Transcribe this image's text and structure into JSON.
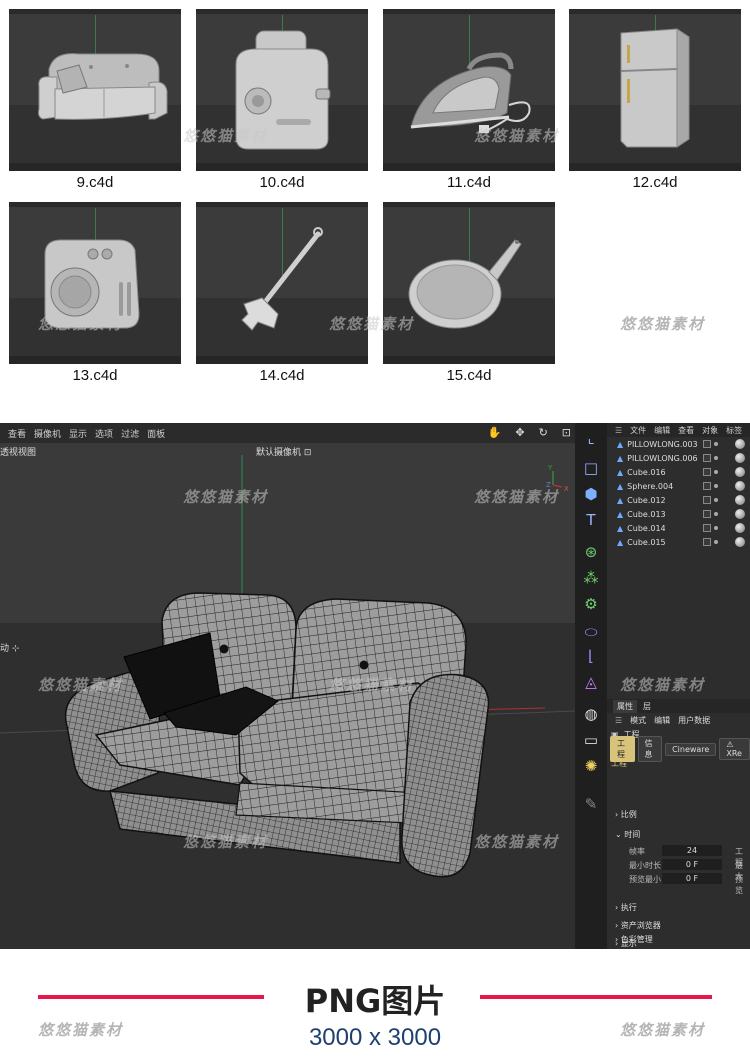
{
  "thumbnails": [
    {
      "caption": "9.c4d",
      "icon": "sofa-model"
    },
    {
      "caption": "10.c4d",
      "icon": "toaster-model"
    },
    {
      "caption": "11.c4d",
      "icon": "iron-model"
    },
    {
      "caption": "12.c4d",
      "icon": "fridge-model"
    },
    {
      "caption": "13.c4d",
      "icon": "washing-machine-model"
    },
    {
      "caption": "14.c4d",
      "icon": "mop-model"
    },
    {
      "caption": "15.c4d",
      "icon": "frying-pan-model"
    }
  ],
  "watermark": "悠悠猫素材",
  "viewport": {
    "menu": [
      "查看",
      "摄像机",
      "显示",
      "选项",
      "过滤",
      "面板"
    ],
    "title": "透视视图",
    "camera": "默认摄像机 ⊡",
    "move_label": "动 ⊹"
  },
  "object_manager": {
    "menu": [
      "文件",
      "编辑",
      "查看",
      "对象",
      "标签"
    ],
    "objects": [
      "PILLOWLONG.003",
      "PILLOWLONG.006",
      "Cube.016",
      "Sphere.004",
      "Cube.012",
      "Cube.013",
      "Cube.014",
      "Cube.015"
    ]
  },
  "attributes": {
    "tabs": [
      "属性",
      "层"
    ],
    "modes": [
      "模式",
      "编辑",
      "用户数据"
    ],
    "header": "工程",
    "buttons": [
      "工程",
      "信息",
      "Cineware",
      "⚠ XRe"
    ],
    "section": "工程",
    "groups": {
      "scale": "比例",
      "time": "时间",
      "execute": "执行",
      "asset_browser": "资产浏览器",
      "display": "显示",
      "color_management": "色彩管理"
    },
    "fields": [
      {
        "label": "帧率",
        "value": "24",
        "right": "工程"
      },
      {
        "label": "最小时长",
        "value": "0 F",
        "right": "最大"
      },
      {
        "label": "预览最小",
        "value": "0 F",
        "right": "预览"
      }
    ]
  },
  "footer": {
    "title": "PNG图片",
    "size": "3000 x 3000"
  },
  "colors": {
    "accent_line": "#e8174b",
    "size_text": "#1f3f70",
    "active_tab": "#d7c47a"
  }
}
